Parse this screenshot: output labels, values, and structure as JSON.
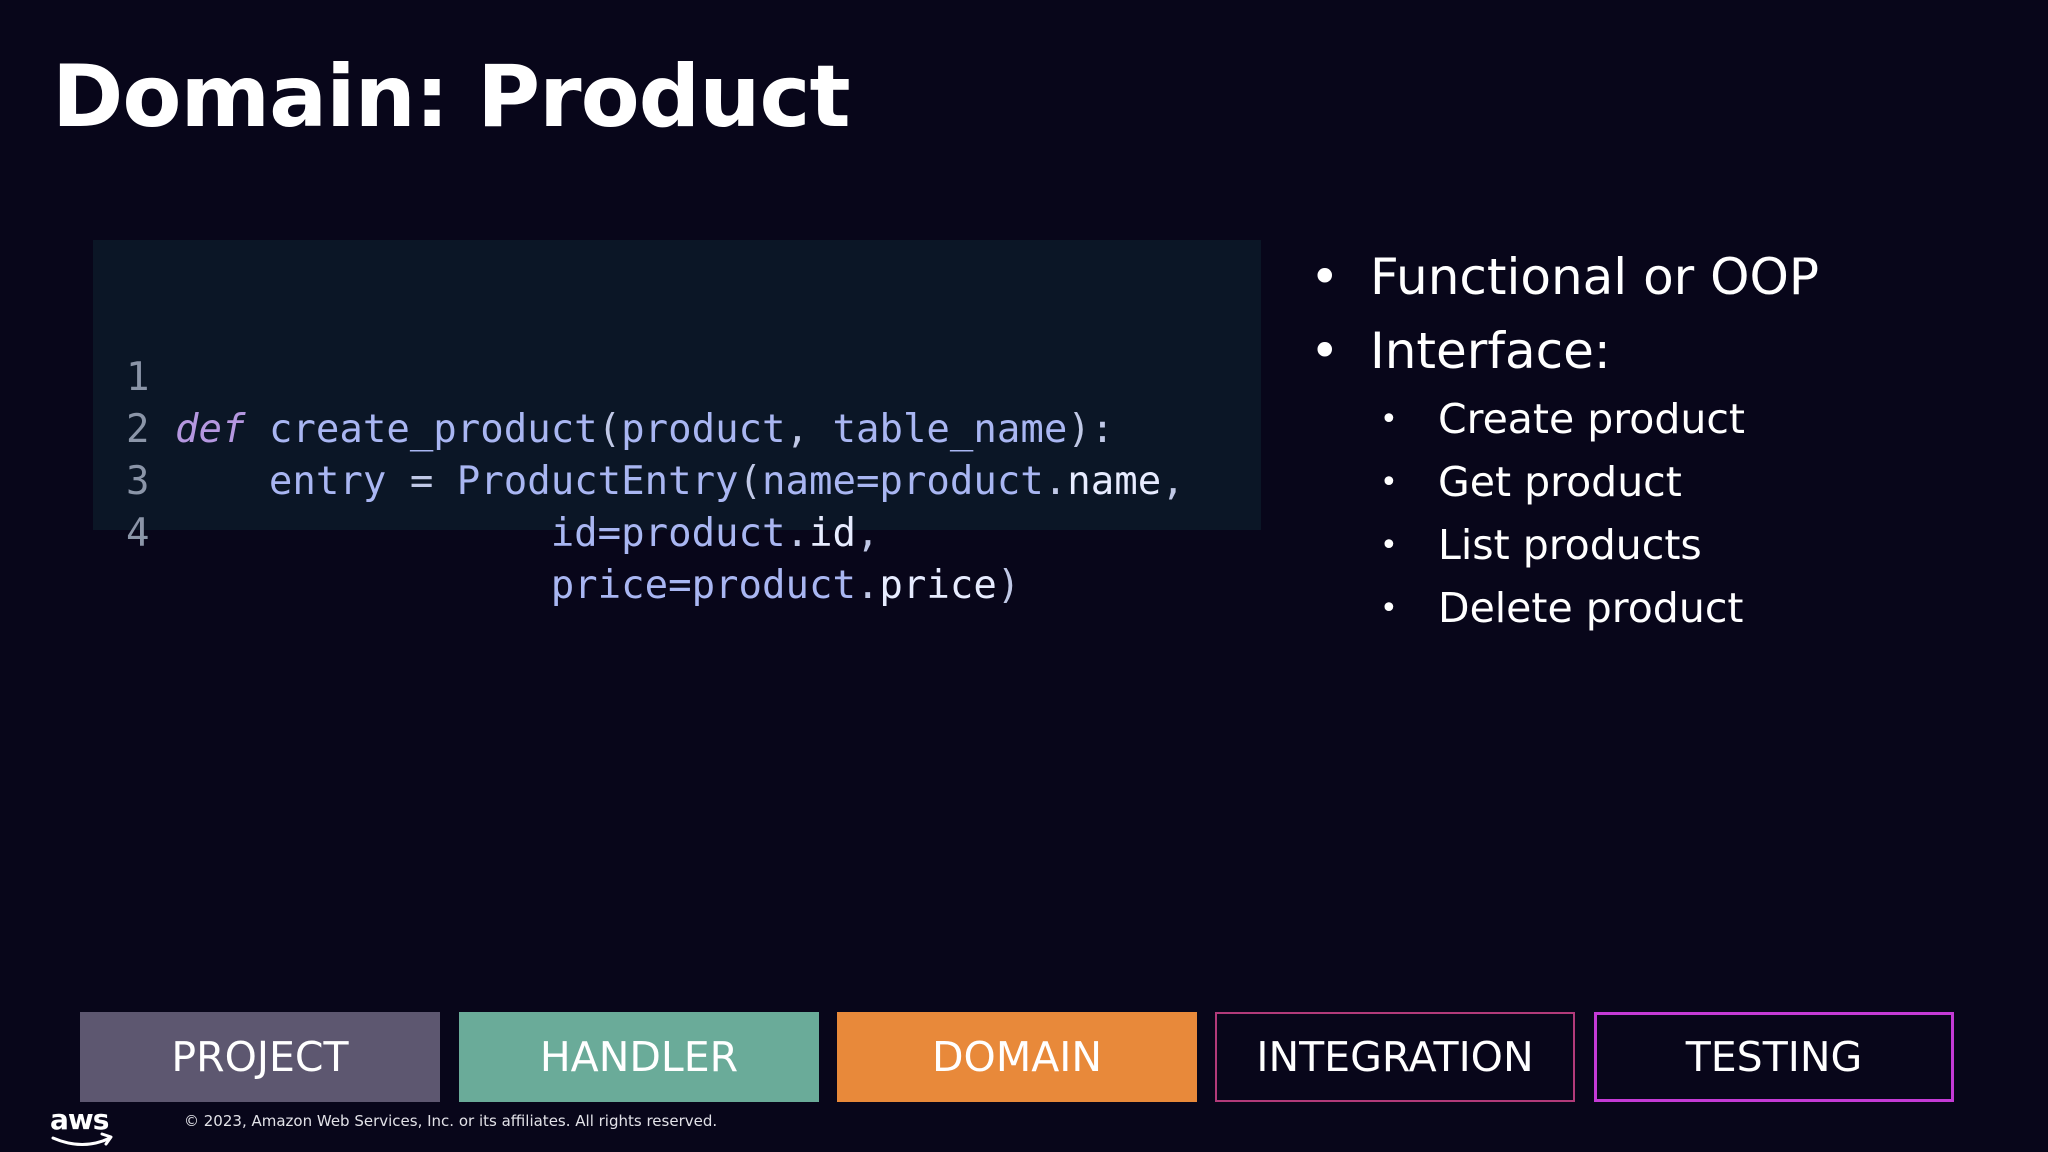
{
  "slide": {
    "title": "Domain: Product"
  },
  "code": {
    "lines": [
      {
        "num": "1",
        "kw": "def",
        "fn": "create_product",
        "open": "(",
        "p1": "product",
        "comma": ",",
        "p2": "table_name",
        "close": "):"
      },
      {
        "num": "2",
        "var": "entry",
        "eq": "=",
        "cls": "ProductEntry",
        "open": "(",
        "arg": "name=product",
        "dot": ".",
        "attr": "name",
        "comma": ","
      },
      {
        "num": "3",
        "arg": "id=product",
        "dot": ".",
        "attr": "id",
        "comma": ","
      },
      {
        "num": "4",
        "arg": "price=product",
        "dot": ".",
        "attr": "price",
        "close": ")"
      }
    ]
  },
  "bullets": {
    "bullet_char": "•",
    "items": [
      "Functional or OOP",
      "Interface:"
    ],
    "sub_items": [
      "Create product",
      "Get product",
      "List products",
      "Delete product"
    ]
  },
  "nav": {
    "items": [
      "PROJECT",
      "HANDLER",
      "DOMAIN",
      "INTEGRATION",
      "TESTING"
    ],
    "colors": {
      "project": "#5d5770",
      "handler": "#6aab99",
      "domain": "#e8893a",
      "integration_border": "#b23a7a",
      "testing_border": "#c43ad6"
    }
  },
  "footer": {
    "logo_text": "aws",
    "copyright": "© 2023, Amazon Web Services, Inc. or its affiliates. All rights reserved."
  }
}
